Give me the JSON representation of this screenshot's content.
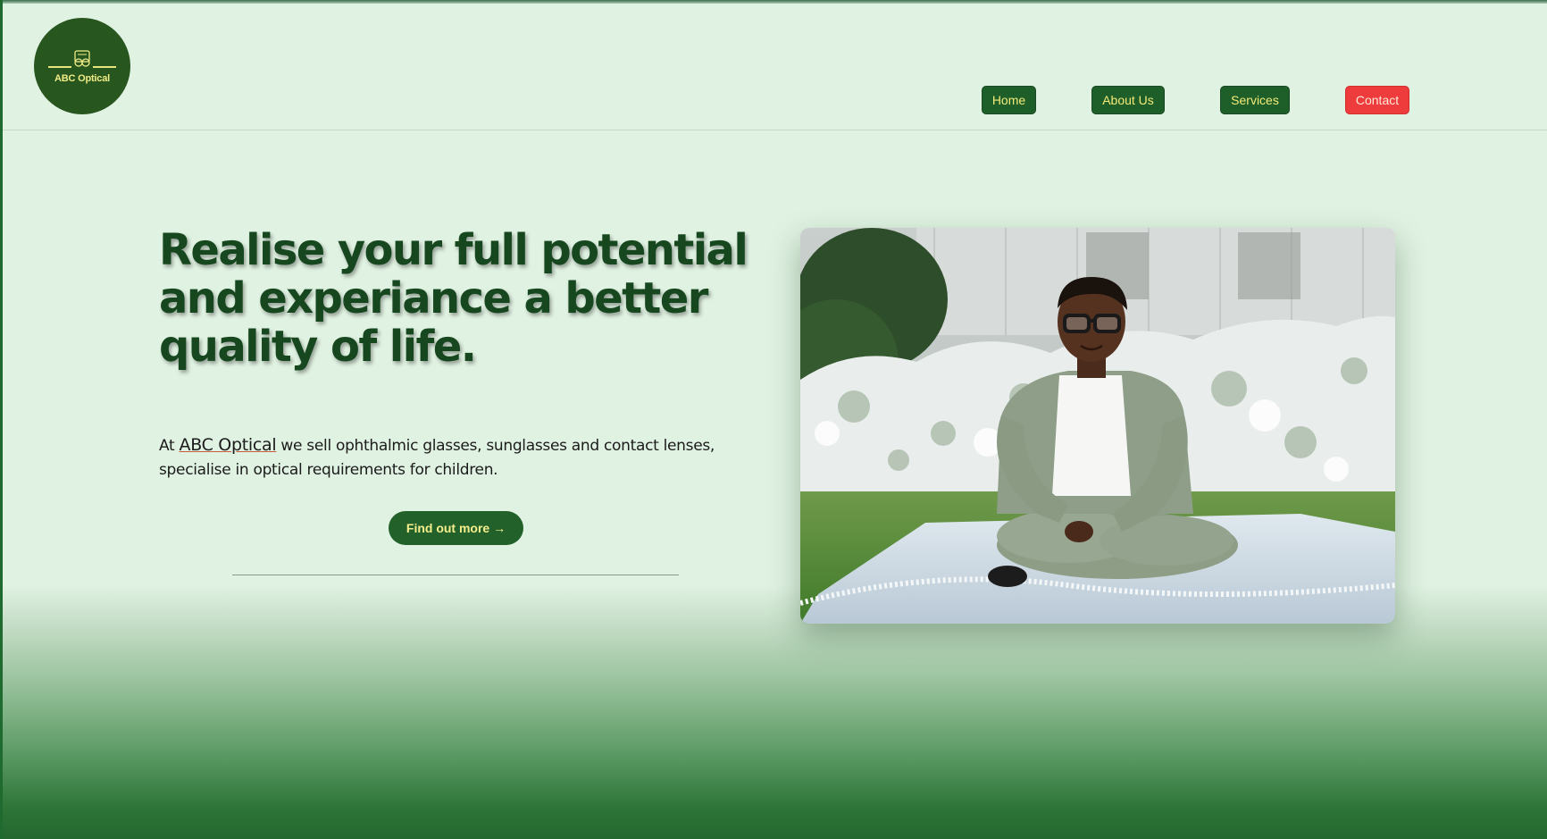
{
  "brand": {
    "logo_text": "ABC Optical",
    "colors": {
      "primary_green": "#1e5e28",
      "accent_yellow": "#f3ea7a",
      "contact_red": "#ee3b3b",
      "background": "#e0f2e2"
    }
  },
  "nav": {
    "items": [
      {
        "label": "Home"
      },
      {
        "label": "About Us"
      },
      {
        "label": "Services"
      },
      {
        "label": "Contact"
      }
    ]
  },
  "hero": {
    "title": "Realise your full potential and experiance a better quality of life.",
    "text_prefix": "At ",
    "brand_link": "ABC Optical",
    "text_suffix": " we sell ophthalmic glasses, sunglasses and contact lenses, specialise in optical requirements for children.",
    "cta_label": "Find out more →",
    "image": {
      "icon": "photo-boy-with-glasses"
    }
  }
}
